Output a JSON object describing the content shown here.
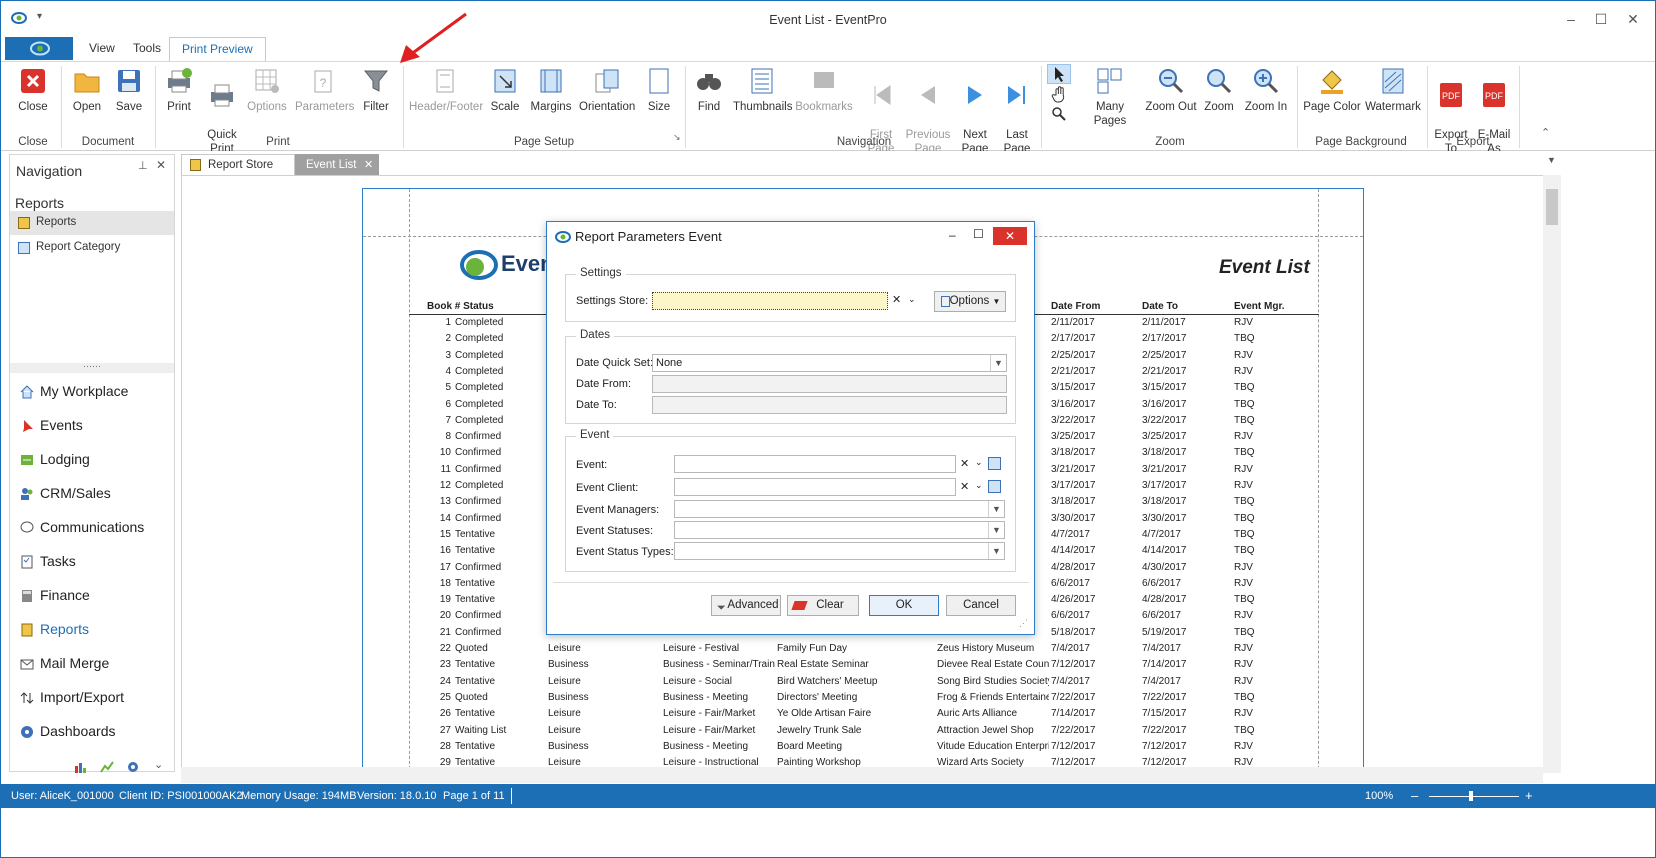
{
  "window": {
    "title": "Event List - EventPro",
    "minimize": "–",
    "maximize": "☐",
    "close": "✕"
  },
  "ribbon_tabs": [
    "View",
    "Tools",
    "Print Preview"
  ],
  "ribbon": {
    "close": {
      "label": "Close",
      "group": "Close"
    },
    "document": {
      "open": "Open",
      "save": "Save",
      "group": "Document"
    },
    "print": {
      "print": "Print",
      "quick_print": "Quick\nPrint",
      "options": "Options",
      "parameters": "Parameters",
      "filter": "Filter",
      "group": "Print"
    },
    "page_setup": {
      "header_footer": "Header/Footer",
      "scale": "Scale",
      "margins": "Margins",
      "orientation": "Orientation",
      "size": "Size",
      "group": "Page Setup"
    },
    "navigation": {
      "find": "Find",
      "thumbnails": "Thumbnails",
      "bookmarks": "Bookmarks",
      "first_page": "First\nPage",
      "previous_page": "Previous\nPage",
      "next_page": "Next\nPage",
      "last_page": "Last\nPage",
      "group": "Navigation"
    },
    "zoom": {
      "many_pages": "Many Pages",
      "zoom_out": "Zoom Out",
      "zoom": "Zoom",
      "zoom_in": "Zoom In",
      "group": "Zoom"
    },
    "page_background": {
      "page_color": "Page Color",
      "watermark": "Watermark",
      "group": "Page Background"
    },
    "export": {
      "export_to": "Export\nTo",
      "email_as": "E-Mail\nAs",
      "group": "Export"
    }
  },
  "nav": {
    "title": "Navigation",
    "section": "Reports",
    "items": [
      "Reports",
      "Report Category"
    ],
    "modules": [
      "My Workplace",
      "Events",
      "Lodging",
      "CRM/Sales",
      "Communications",
      "Tasks",
      "Finance",
      "Reports",
      "Mail Merge",
      "Import/Export",
      "Dashboards"
    ]
  },
  "doc_tabs": [
    "Report Store",
    "Event List"
  ],
  "report": {
    "logo_text": "Event",
    "title": "Event List",
    "headers": {
      "book_status": "Book # Status",
      "date_from": "Date From",
      "date_to": "Date To",
      "mgr": "Event Mgr."
    },
    "rows_top": [
      [
        "1",
        "Completed",
        "2/11/2017",
        "2/11/2017",
        "RJV"
      ],
      [
        "2",
        "Completed",
        "2/17/2017",
        "2/17/2017",
        "TBQ"
      ],
      [
        "3",
        "Completed",
        "2/25/2017",
        "2/25/2017",
        "RJV"
      ],
      [
        "4",
        "Completed",
        "2/21/2017",
        "2/21/2017",
        "RJV"
      ],
      [
        "5",
        "Completed",
        "3/15/2017",
        "3/15/2017",
        "TBQ"
      ],
      [
        "6",
        "Completed",
        "3/16/2017",
        "3/16/2017",
        "TBQ"
      ],
      [
        "7",
        "Completed",
        "3/22/2017",
        "3/22/2017",
        "TBQ"
      ],
      [
        "8",
        "Confirmed",
        "3/25/2017",
        "3/25/2017",
        "RJV"
      ],
      [
        "10",
        "Confirmed",
        "3/18/2017",
        "3/18/2017",
        "TBQ"
      ],
      [
        "11",
        "Confirmed",
        "3/21/2017",
        "3/21/2017",
        "RJV"
      ],
      [
        "12",
        "Completed",
        "3/17/2017",
        "3/17/2017",
        "RJV"
      ],
      [
        "13",
        "Confirmed",
        "3/18/2017",
        "3/18/2017",
        "TBQ"
      ],
      [
        "14",
        "Confirmed",
        "3/30/2017",
        "3/30/2017",
        "TBQ"
      ],
      [
        "15",
        "Tentative",
        "4/7/2017",
        "4/7/2017",
        "TBQ"
      ],
      [
        "16",
        "Tentative",
        "4/14/2017",
        "4/14/2017",
        "TBQ"
      ],
      [
        "17",
        "Confirmed",
        "4/28/2017",
        "4/30/2017",
        "RJV"
      ],
      [
        "18",
        "Tentative",
        "6/6/2017",
        "6/6/2017",
        "RJV"
      ],
      [
        "19",
        "Tentative",
        "4/26/2017",
        "4/28/2017",
        "TBQ"
      ],
      [
        "20",
        "Confirmed",
        "6/6/2017",
        "6/6/2017",
        "RJV"
      ],
      [
        "21",
        "Confirmed",
        "5/18/2017",
        "5/19/2017",
        "TBQ"
      ]
    ],
    "side_frag": [
      "",
      "on",
      "e",
      "",
      "",
      "ub",
      "",
      "",
      "e",
      "any",
      "",
      "s",
      "ion",
      "",
      "",
      "",
      "ub",
      "",
      "",
      ""
    ],
    "rows_bottom": [
      [
        "22",
        "Quoted",
        "Leisure",
        "Leisure - Festival",
        "Family Fun Day",
        "Zeus History Museum",
        "7/4/2017",
        "7/4/2017",
        "RJV"
      ],
      [
        "23",
        "Tentative",
        "Business",
        "Business - Seminar/Traini",
        "Real Estate Seminar",
        "Dievee Real Estate Counci",
        "7/12/2017",
        "7/14/2017",
        "RJV"
      ],
      [
        "24",
        "Tentative",
        "Leisure",
        "Leisure - Social",
        "Bird Watchers' Meetup",
        "Song Bird Studies Society",
        "7/4/2017",
        "7/4/2017",
        "RJV"
      ],
      [
        "25",
        "Quoted",
        "Business",
        "Business - Meeting",
        "Directors' Meeting",
        "Frog & Friends Entertaine",
        "7/22/2017",
        "7/22/2017",
        "TBQ"
      ],
      [
        "26",
        "Tentative",
        "Leisure",
        "Leisure - Fair/Market",
        "Ye Olde Artisan Faire",
        "Auric Arts Alliance",
        "7/14/2017",
        "7/15/2017",
        "RJV"
      ],
      [
        "27",
        "Waiting List",
        "Leisure",
        "Leisure - Fair/Market",
        "Jewelry Trunk Sale",
        "Attraction Jewel Shop",
        "7/22/2017",
        "7/22/2017",
        "TBQ"
      ],
      [
        "28",
        "Tentative",
        "Business",
        "Business - Meeting",
        "Board Meeting",
        "Vitude Education Enterpri",
        "7/12/2017",
        "7/12/2017",
        "RJV"
      ],
      [
        "29",
        "Tentative",
        "Leisure",
        "Leisure - Instructional",
        "Painting Workshop",
        "Wizard Arts Society",
        "7/12/2017",
        "7/12/2017",
        "RJV"
      ]
    ]
  },
  "dialog": {
    "title": "Report Parameters Event",
    "settings": {
      "legend": "Settings",
      "store_label": "Settings Store:",
      "store_value": "",
      "options": "Options"
    },
    "dates": {
      "legend": "Dates",
      "quick_set_label": "Date Quick Set:",
      "quick_set_value": "None",
      "from_label": "Date From:",
      "to_label": "Date To:"
    },
    "event": {
      "legend": "Event",
      "event_label": "Event:",
      "client_label": "Event Client:",
      "managers_label": "Event Managers:",
      "statuses_label": "Event Statuses:",
      "status_types_label": "Event Status Types:"
    },
    "buttons": {
      "advanced": "Advanced",
      "clear": "Clear",
      "ok": "OK",
      "cancel": "Cancel"
    }
  },
  "status": {
    "user": "User: AliceK_001000",
    "client": "Client ID: PSI001000AK2",
    "memory": "Memory Usage: 194MB",
    "version": "Version: 18.0.10",
    "page": "Page 1 of 11",
    "zoom": "100%"
  },
  "colors": {
    "accent": "#1c6fb5",
    "arrow": "#e02020"
  }
}
